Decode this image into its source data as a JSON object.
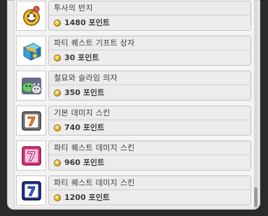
{
  "items": [
    {
      "name": "투사의 반지",
      "price": "1480 포인트",
      "icon": "ring-icon"
    },
    {
      "name": "파티 퀘스트 기프트 상자",
      "price": "30 포인트",
      "icon": "gift-box-icon"
    },
    {
      "name": "철묘와 슬라임 의자",
      "price": "350 포인트",
      "icon": "cat-slime-chair-icon"
    },
    {
      "name": "기본 데미지 스킨",
      "price": "740 포인트",
      "icon": "damage-skin-basic-icon"
    },
    {
      "name": "파티 퀘스트 데미지 스킨",
      "price": "960 포인트",
      "icon": "damage-skin-pink-icon"
    },
    {
      "name": "파티 퀘스트 데미지 스킨",
      "price": "1200 포인트",
      "icon": "damage-skin-blue-icon"
    }
  ]
}
